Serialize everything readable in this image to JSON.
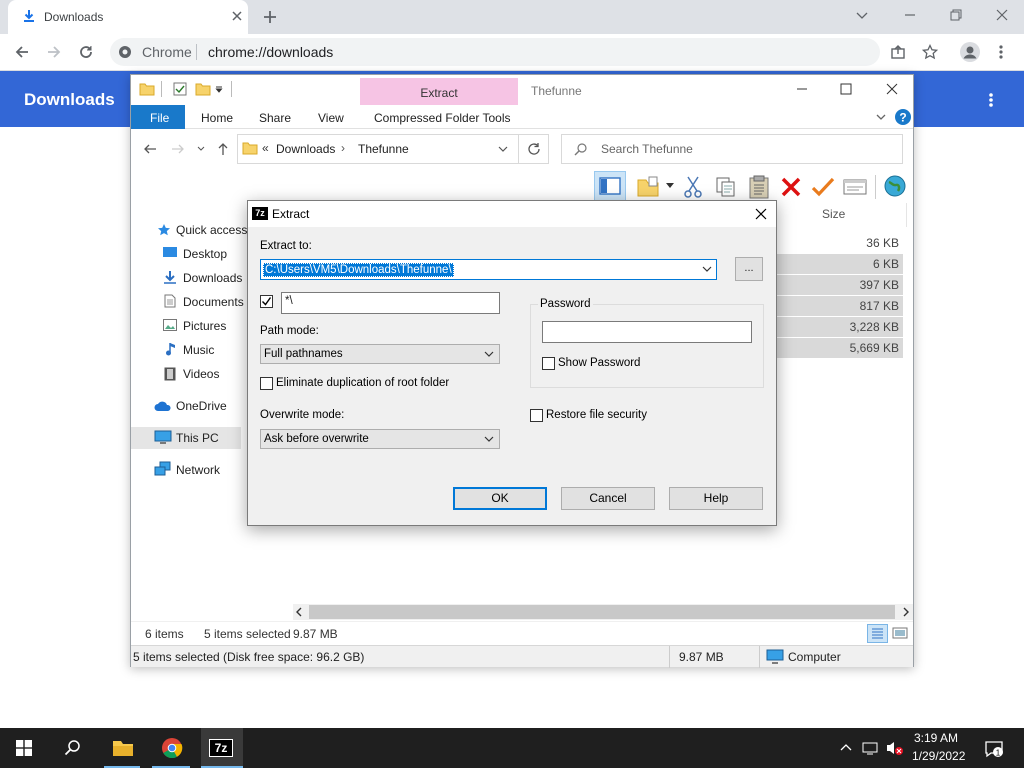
{
  "chrome": {
    "tab_title": "Downloads",
    "site_name": "Chrome",
    "url": "chrome://downloads",
    "page_title": "Downloads"
  },
  "explorer": {
    "title": "Thefunne",
    "context_tab": "Extract",
    "ribbon_tabs": [
      "File",
      "Home",
      "Share",
      "View",
      "Compressed Folder Tools"
    ],
    "breadcrumb": [
      "Downloads",
      "Thefunne"
    ],
    "search_placeholder": "Search Thefunne",
    "nav_items": [
      "Quick access",
      "Desktop",
      "Downloads",
      "Documents",
      "Pictures",
      "Music",
      "Videos",
      "OneDrive",
      "This PC",
      "Network"
    ],
    "column_size": "Size",
    "sizes": [
      "36 KB",
      "6 KB",
      "397 KB",
      "817 KB",
      "3,228 KB",
      "5,669 KB"
    ],
    "status_items": "6 items",
    "status_selected": "5 items selected",
    "status_size": "9.87 MB",
    "bottom_status": "5 items selected (Disk free space: 96.2 GB)",
    "bottom_size": "9.87 MB",
    "bottom_location": "Computer"
  },
  "dialog": {
    "title": "Extract",
    "icon_text": "7z",
    "extract_to_label": "Extract to:",
    "extract_to_value": "C:\\Users\\VM5\\Downloads\\Thefunne\\",
    "browse_label": "...",
    "filter_value": "*\\",
    "path_mode_label": "Path mode:",
    "path_mode_value": "Full pathnames",
    "eliminate_label": "Eliminate duplication of root folder",
    "overwrite_label": "Overwrite mode:",
    "overwrite_value": "Ask before overwrite",
    "password_label": "Password",
    "show_password_label": "Show Password",
    "restore_label": "Restore file security",
    "ok": "OK",
    "cancel": "Cancel",
    "help": "Help"
  },
  "taskbar": {
    "time": "3:19 AM",
    "date": "1/29/2022",
    "app_7z": "7z"
  }
}
